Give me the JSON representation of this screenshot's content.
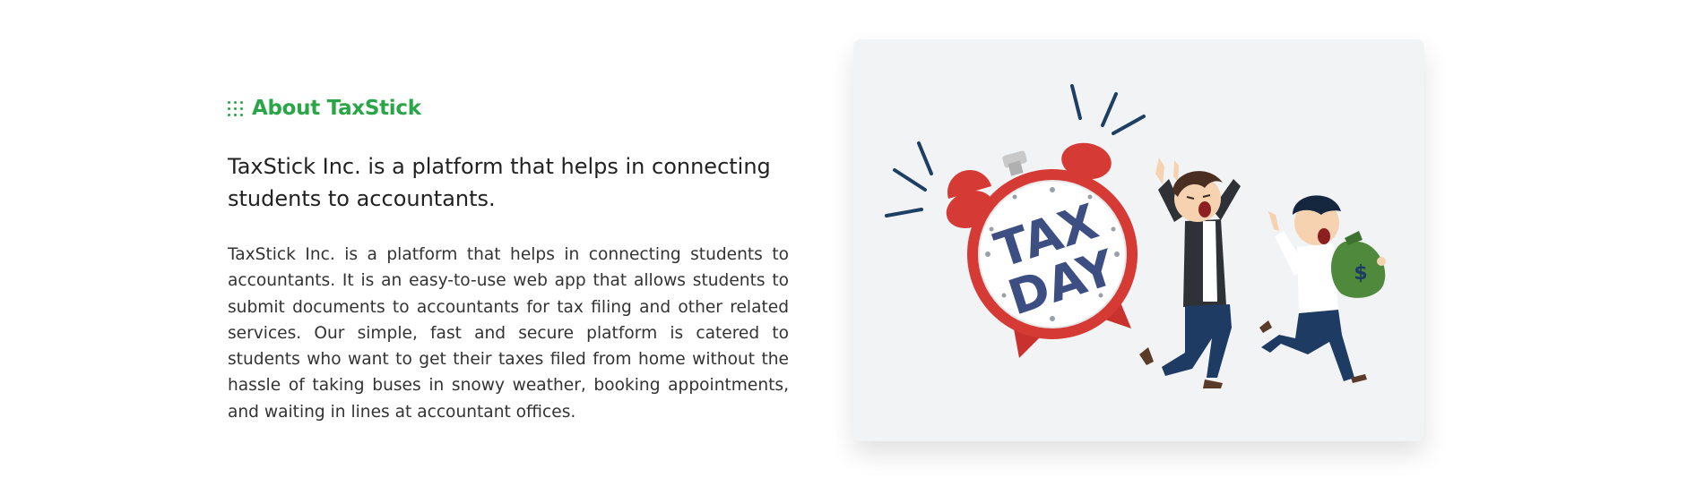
{
  "about": {
    "eyebrow": "About TaxStick",
    "eyebrow_icon": "grid-dots-icon",
    "lead": "TaxStick Inc. is a platform that helps in connecting students to accountants.",
    "body": "TaxStick Inc. is a platform that helps in connecting students to accountants. It is an easy-to-use web app that allows students to submit documents to accountants for tax filing and other related services. Our simple, fast and secure platform is catered to students who want to get their taxes filed from home without the hassle of taking buses in snowy weather, booking appointments, and waiting in lines at accountant offices."
  },
  "illustration": {
    "clock_text_line1": "TAX",
    "clock_text_line2": "DAY",
    "bag_symbol": "$",
    "colors": {
      "accent_green": "#2aa547",
      "clock_red": "#d63a35",
      "clock_face": "#ffffff",
      "tax_day_text": "#3d4e82",
      "card_bg": "#f2f3f5",
      "money_bag": "#4f8a3c"
    }
  }
}
